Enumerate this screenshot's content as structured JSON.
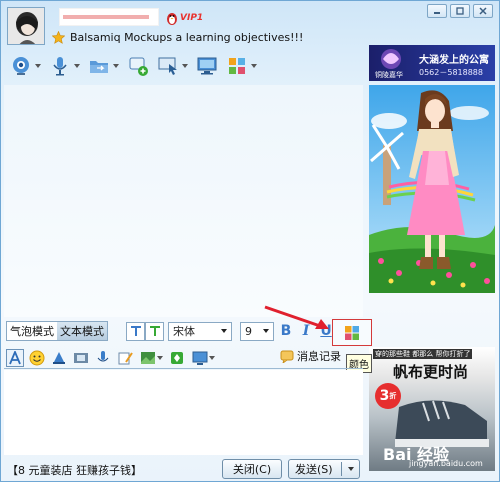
{
  "header": {
    "status_message": "Balsamiq Mockups a learning objectives!!!",
    "vip_label": "VIP1"
  },
  "toolbar": {
    "items": [
      {
        "icon": "webcam-icon"
      },
      {
        "icon": "microphone-icon"
      },
      {
        "icon": "folder-icon"
      },
      {
        "icon": "add-chat-icon"
      },
      {
        "icon": "remote-desktop-icon"
      },
      {
        "icon": "screen-share-icon"
      },
      {
        "icon": "apps-icon"
      }
    ]
  },
  "ads": {
    "top_title": "大涵发上的公寓",
    "top_phone": "0562－5818888",
    "top_brand": "铜陵嘉华",
    "bottom_promo": "穿的那些鞋 都那么 帮你打折了",
    "bottom_caption": "帆布更时尚",
    "bottom_discount": "3",
    "bottom_discount_unit": "折",
    "watermark": "Bai 经验",
    "watermark_url": "jingyan.baidu.com"
  },
  "format_bar": {
    "mode_bubble": "气泡模式",
    "mode_text": "文本模式",
    "font_name": "宋体",
    "font_size": "9",
    "bold": "B",
    "italic": "I",
    "underline": "U",
    "color_tooltip": "颜色"
  },
  "tools_bar": {
    "history_label": "消息记录"
  },
  "footer": {
    "promo_text": "【8 元童装店 狂赚孩子钱】",
    "close_button": "关闭(C)",
    "send_button": "发送(S)"
  },
  "colors": {
    "accent": "#3a79c8",
    "highlight_border": "#d43a3a",
    "pointer_arrow": "#e0202e"
  }
}
